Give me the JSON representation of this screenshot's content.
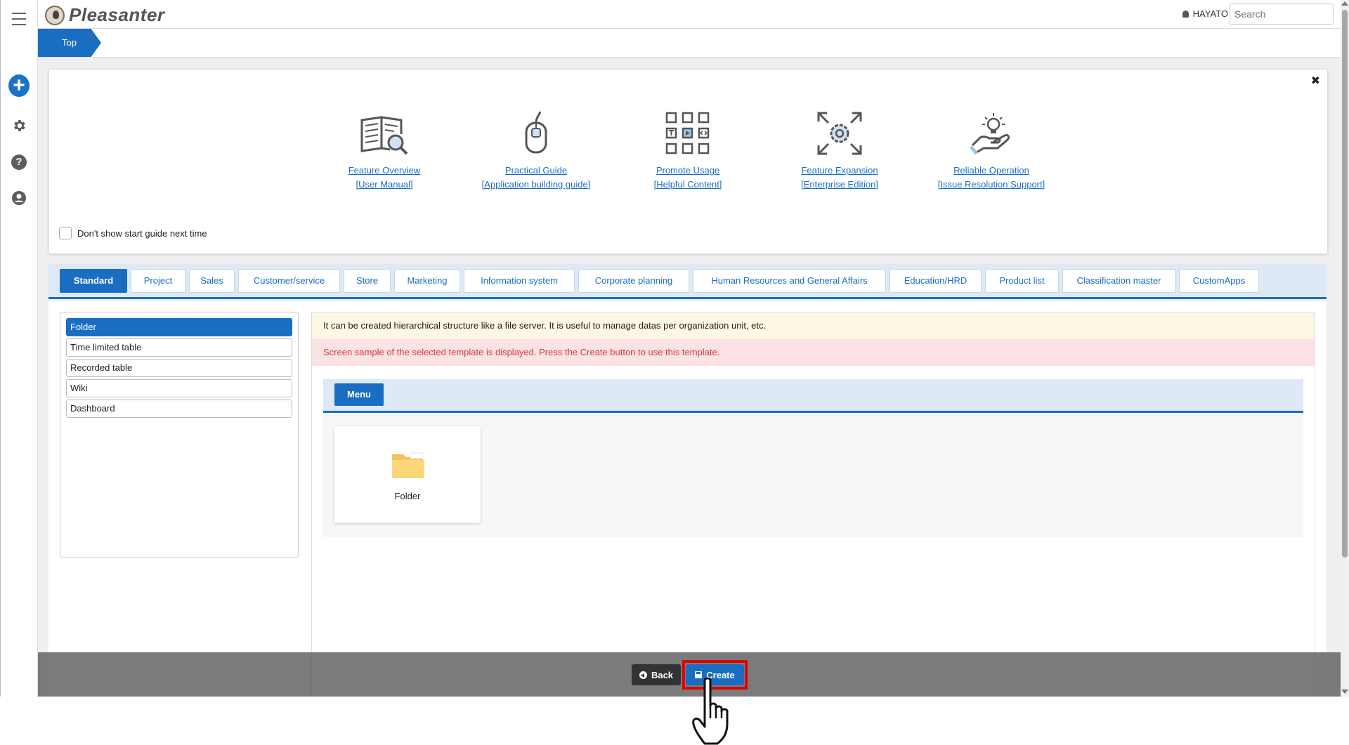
{
  "header": {
    "app_name": "Pleasanter",
    "user_name": "HAYATO",
    "search_placeholder": "Search"
  },
  "breadcrumb": {
    "top_label": "Top"
  },
  "guide": {
    "items": [
      {
        "title": "Feature Overview",
        "sub": "[User Manual]",
        "icon": "book-search-icon"
      },
      {
        "title": "Practical Guide",
        "sub": "[Application building guide]",
        "icon": "mouse-click-icon"
      },
      {
        "title": "Promote Usage",
        "sub": "[Helpful Content]",
        "icon": "content-grid-icon"
      },
      {
        "title": "Feature Expansion",
        "sub": "[Enterprise Edition]",
        "icon": "expand-gear-icon"
      },
      {
        "title": "Reliable Operation",
        "sub": "[Issue Resolution Support]",
        "icon": "hand-bulb-icon"
      }
    ],
    "dont_show_label": "Don't show start guide next time"
  },
  "tabs": [
    "Standard",
    "Project",
    "Sales",
    "Customer/service",
    "Store",
    "Marketing",
    "Information system",
    "Corporate planning",
    "Human Resources and General Affairs",
    "Education/HRD",
    "Product list",
    "Classification master",
    "CustomApps"
  ],
  "active_tab": "Standard",
  "templates": [
    "Folder",
    "Time limited table",
    "Recorded table",
    "Wiki",
    "Dashboard"
  ],
  "selected_template": "Folder",
  "preview": {
    "description": "It can be created hierarchical structure like a file server. It is useful to manage datas per organization unit, etc.",
    "hint": "Screen sample of the selected template is displayed. Press the Create button to use this template.",
    "menu_label": "Menu",
    "card_label": "Folder"
  },
  "footer": {
    "back_label": "Back",
    "create_label": "Create"
  },
  "colors": {
    "accent": "#1a6ec2",
    "highlight": "#e00000",
    "hint_text": "#d23b3b"
  }
}
